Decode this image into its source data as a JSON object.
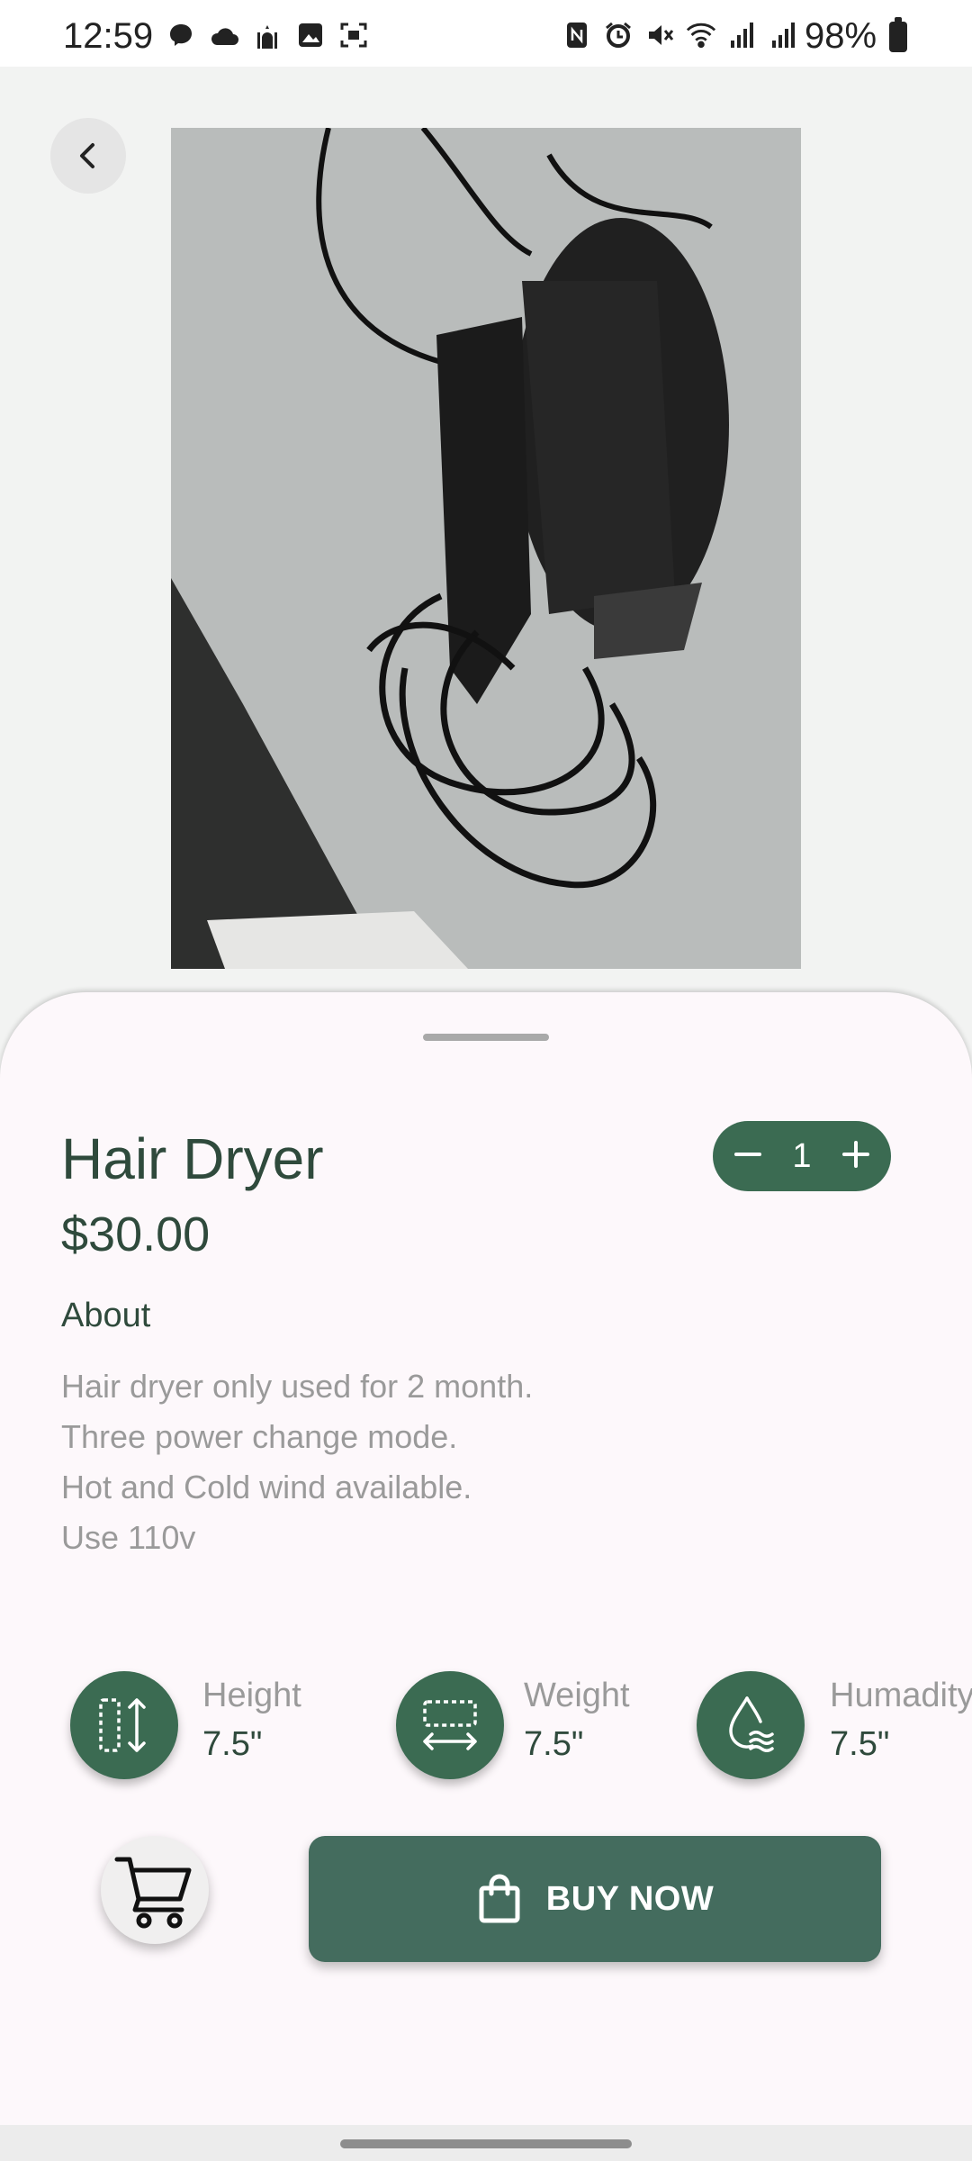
{
  "status_bar": {
    "time": "12:59",
    "battery": "98%",
    "left_icons": [
      "messenger-icon",
      "cloud-icon",
      "mosque-icon",
      "gallery-icon",
      "screen-capture-icon"
    ],
    "right_icons": [
      "nfc-icon",
      "alarm-icon",
      "mute-icon",
      "wifi-icon",
      "signal-icon",
      "signal-icon"
    ]
  },
  "product": {
    "title": "Hair Dryer",
    "price": "$30.00",
    "quantity": "1",
    "about_heading": "About",
    "about_lines": [
      "Hair dryer only used for 2 month.",
      "Three power change mode.",
      "Hot and Cold wind available.",
      "Use 110v"
    ]
  },
  "specs": [
    {
      "label": "Height",
      "value": "7.5\"",
      "icon": "height-icon"
    },
    {
      "label": "Weight",
      "value": "7.5\"",
      "icon": "width-icon"
    },
    {
      "label": "Humadity",
      "value": "7.5\"",
      "icon": "humidity-icon"
    }
  ],
  "actions": {
    "buy_label": "BUY NOW"
  },
  "colors": {
    "accent": "#3b6b52",
    "buy_button": "#446c5e",
    "title_text": "#2f4a3c",
    "muted_text": "#9a9a9a",
    "sheet_bg": "#fdf8fb"
  }
}
